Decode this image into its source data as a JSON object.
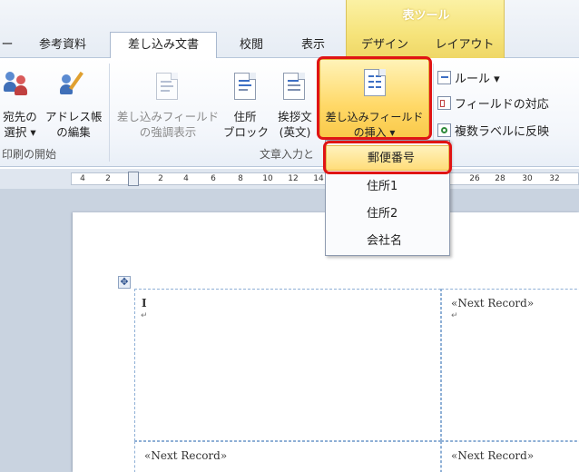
{
  "tabs": {
    "partial_left": "ー",
    "references": "参考資料",
    "mailings": "差し込み文書",
    "review": "校閲",
    "view": "表示",
    "context_title": "表ツール",
    "design": "デザイン",
    "layout": "レイアウト"
  },
  "ribbon": {
    "recipients_line1": "宛先の",
    "recipients_line2": "選択 ▾",
    "edit_list_line1": "アドレス帳",
    "edit_list_line2": "の編集",
    "group_start": "印刷の開始",
    "highlight_line1": "差し込みフィールド",
    "highlight_line2": "の強調表示",
    "address_line1": "住所",
    "address_line2": "ブロック",
    "greeting_line1": "挨拶文",
    "greeting_line2": "(英文)",
    "group_write": "文章入力と",
    "insert_field_line1": "差し込みフィールド",
    "insert_field_line2": "の挿入 ▾",
    "rules": "ルール ▾",
    "match_fields": "フィールドの対応",
    "update_labels": "複数ラベルに反映"
  },
  "ruler": {
    "ticks": [
      "4",
      "2",
      "2",
      "4",
      "6",
      "8",
      "10",
      "12",
      "14",
      "26",
      "28",
      "30",
      "32"
    ]
  },
  "dropdown": {
    "items": [
      "郵便番号",
      "住所1",
      "住所2",
      "会社名"
    ],
    "selected": "郵便番号"
  },
  "document": {
    "next_record_1": "«Next Record»",
    "next_record_2": "«Next Record»",
    "next_record_3": "«Next Record»",
    "cursor_mark": "I",
    "move_handle": "✥"
  },
  "colors": {
    "accent_red": "#e01414",
    "context_yellow": "#f6e37a",
    "hover_gold": "#ffd866"
  }
}
